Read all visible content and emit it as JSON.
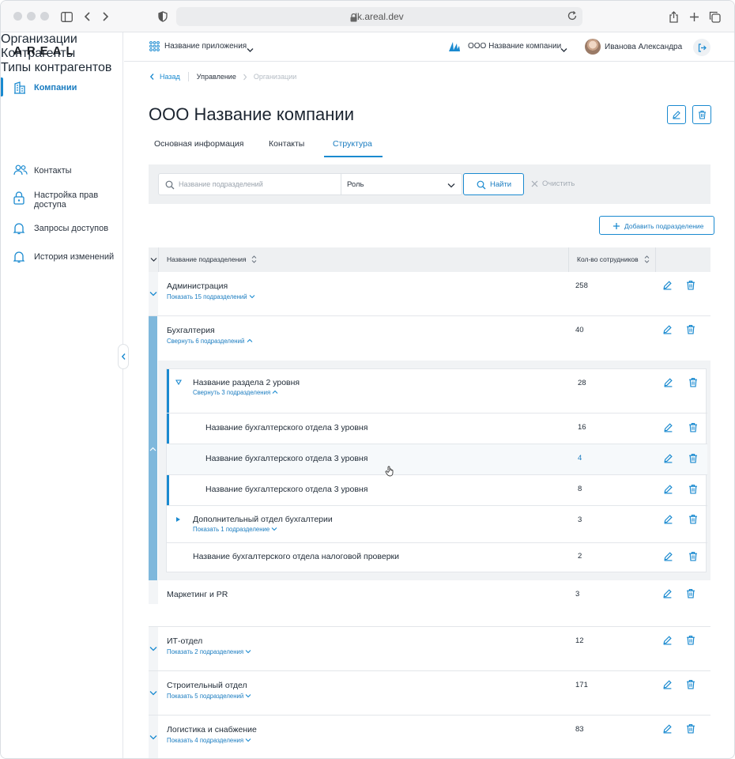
{
  "browser": {
    "url": "lk.areal.dev"
  },
  "brand": {
    "logo": "AREAL",
    "accent": "#1a8ad0"
  },
  "sidebar": {
    "companies": "Компании",
    "sub": [
      "Организации",
      "Контрагенты",
      "Типы контрагентов"
    ],
    "contacts": "Контакты",
    "access_l1": "Настройка прав",
    "access_l2": "доступа",
    "requests": "Запросы доступов",
    "history": "История изменений"
  },
  "topbar": {
    "app": "Название приложения",
    "company": "ООО Название компании",
    "user": "Иванова Александра"
  },
  "breadcrumb": {
    "back": "Назад",
    "manage": "Управление",
    "orgs": "Организации"
  },
  "page": {
    "title": "ООО Название компании"
  },
  "tabs": [
    "Основная информация",
    "Контакты",
    "Структура"
  ],
  "filter": {
    "search_placeholder": "Название подразделений",
    "role": "Роль",
    "find": "Найти",
    "clear": "Очистить"
  },
  "add_button": "Добавить подразделение",
  "table": {
    "col_name": "Название подразделения",
    "col_count": "Кол-во сотрудников",
    "rows": [
      {
        "name": "Администрация",
        "link": "Показать 15 подразделений",
        "count": "258"
      },
      {
        "name": "Бухгалтерия",
        "link": "Свернуть 6 подразделений",
        "count": "40"
      },
      {
        "name": "Маркетинг и PR",
        "count": "3"
      },
      {
        "name": "ИТ-отдел",
        "link": "Показать 2 подразделения",
        "count": "12"
      },
      {
        "name": "Строительный отдел",
        "link": "Показать 5 подразделений",
        "count": "171"
      },
      {
        "name": "Логистика и снабжение",
        "link": "Показать 4 подразделения",
        "count": "83"
      }
    ],
    "nested": [
      {
        "name": "Название раздела 2 уровня",
        "link": "Свернуть 3 подразделения",
        "count": "28"
      },
      {
        "name": "Название бухгалтерского отдела 3 уровня",
        "count": "16"
      },
      {
        "name": "Название бухгалтерского отдела 3 уровня",
        "count": "4"
      },
      {
        "name": "Название бухгалтерского отдела 3 уровня",
        "count": "8"
      },
      {
        "name": "Дополнительный отдел бухгалтерии",
        "link": "Показать 1 подразделение",
        "count": "3"
      },
      {
        "name": "Название бухгалтерского отдела налоговой проверки",
        "count": "2"
      }
    ]
  }
}
